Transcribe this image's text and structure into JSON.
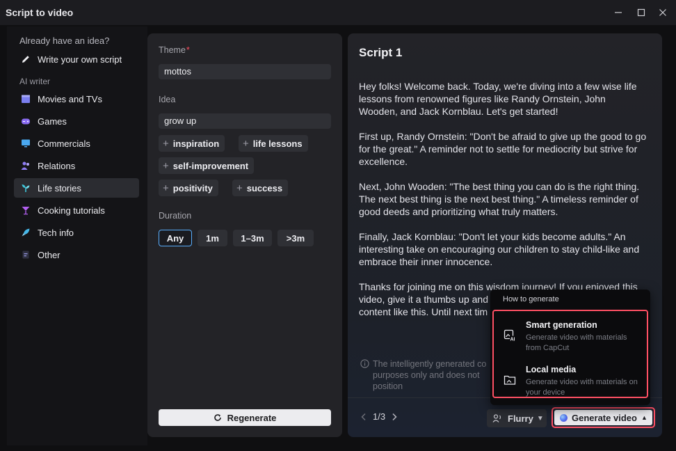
{
  "window": {
    "title": "Script to video"
  },
  "sidebar": {
    "heading_idea": "Already have an idea?",
    "write_own": "Write your own script",
    "heading_ai": "AI writer",
    "items": [
      {
        "label": "Movies and TVs",
        "icon": "clapperboard-icon",
        "color": "#7b7ff0"
      },
      {
        "label": "Games",
        "icon": "gamepad-icon",
        "color": "#8a6cf2"
      },
      {
        "label": "Commercials",
        "icon": "monitor-icon",
        "color": "#4aa8f0"
      },
      {
        "label": "Relations",
        "icon": "people-icon",
        "color": "#8f7cf5"
      },
      {
        "label": "Life stories",
        "icon": "sprout-icon",
        "color": "#3fc4d8",
        "active": true
      },
      {
        "label": "Cooking tutorials",
        "icon": "cocktail-icon",
        "color": "#b25ff0"
      },
      {
        "label": "Tech info",
        "icon": "rocket-icon",
        "color": "#46b7e8"
      },
      {
        "label": "Other",
        "icon": "document-icon",
        "color": "#9a9ce8"
      }
    ]
  },
  "form": {
    "theme_label": "Theme",
    "required_mark": "*",
    "theme_value": "mottos",
    "idea_label": "Idea",
    "idea_value": "grow up",
    "chips": [
      "inspiration",
      "life lessons",
      "self-improvement",
      "positivity",
      "success"
    ],
    "duration_label": "Duration",
    "durations": [
      "Any",
      "1m",
      "1–3m",
      ">3m"
    ],
    "selected_duration": "Any",
    "regenerate_label": "Regenerate"
  },
  "script": {
    "title": "Script 1",
    "paragraphs": [
      "Hey folks! Welcome back. Today, we're diving into a few wise life lessons from renowned figures like Randy Ornstein, John Wooden, and Jack Kornblau. Let's get started!",
      "First up, Randy Ornstein: \"Don't be afraid to give up the good to go for the great.\" A reminder not to settle for mediocrity but strive for excellence.",
      "Next, John Wooden: \"The best thing you can do is the right thing. The next best thing is the next best thing.\" A timeless reminder of good deeds and prioritizing what truly matters.",
      "Finally, Jack Kornblau: \"Don't let your kids become adults.\" An interesting take on encouraging our children to stay child-like and embrace their inner innocence.",
      "Thanks for joining me on this wisdom journey! If you enjoyed this video, give it a thumbs up and",
      "content like this. Until next tim"
    ],
    "notice": "The intelligently generated co purposes only and does not position",
    "page": "1/3",
    "voice_label": "Flurry",
    "generate_label": "Generate video"
  },
  "popup": {
    "heading": "How to generate",
    "options": [
      {
        "title": "Smart generation",
        "desc": "Generate video with materials from CapCut",
        "icon": "ai-image-icon"
      },
      {
        "title": "Local media",
        "desc": "Generate video with materials on your device",
        "icon": "folder-media-icon"
      }
    ]
  },
  "colors": {
    "accent": "#5ab0ff",
    "highlight": "#ff5064",
    "required": "#ff4d5e"
  }
}
